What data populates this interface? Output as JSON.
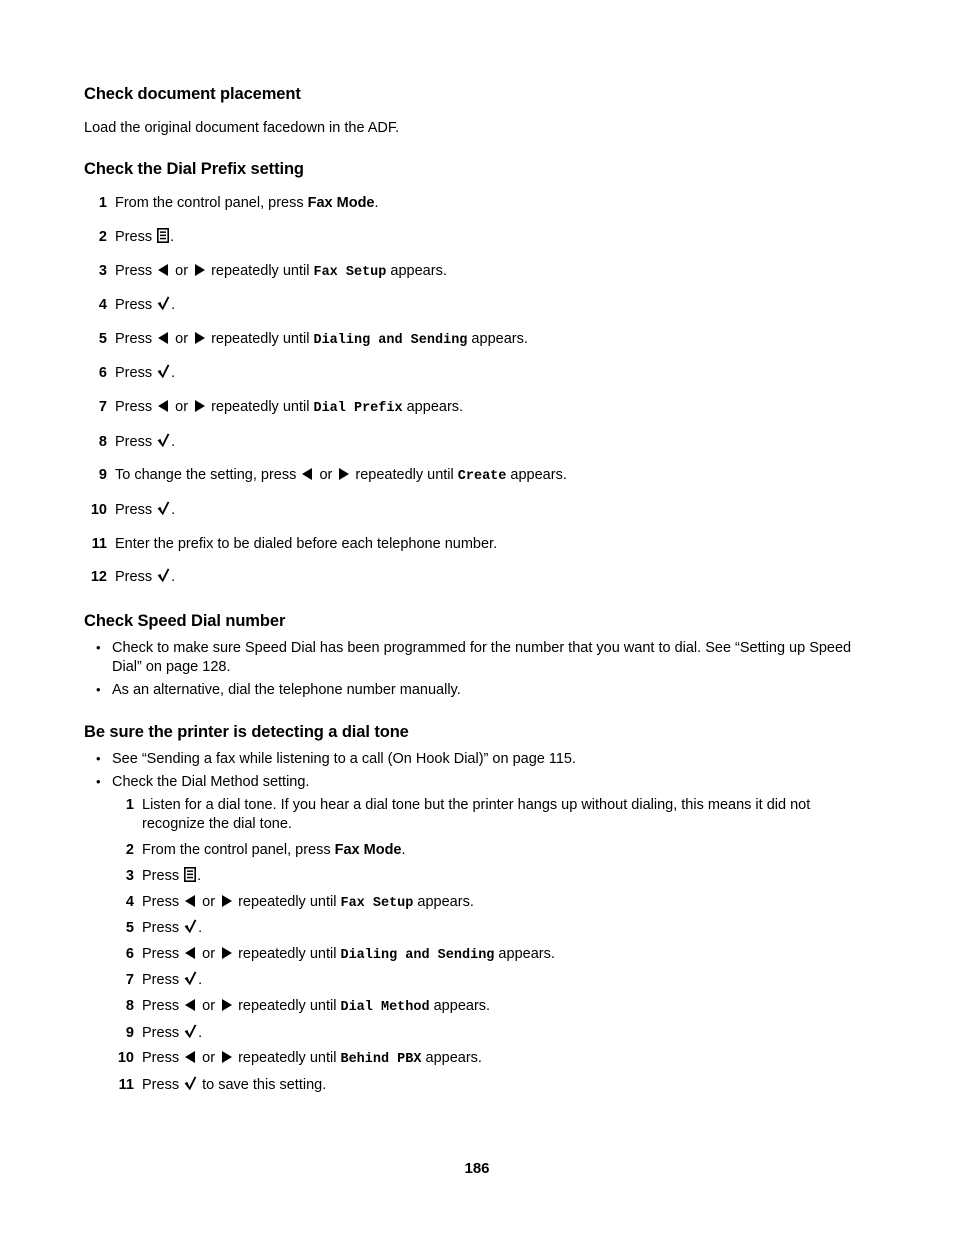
{
  "page": {
    "number": "186"
  },
  "sections": [
    {
      "heading": "Check document placement",
      "body": "Load the original document facedown in the ADF."
    },
    {
      "heading": "Check the Dial Prefix setting",
      "steps": [
        {
          "num": "1",
          "pre": "From the control panel, press ",
          "strong": "Fax Mode",
          "post": "."
        },
        {
          "num": "2",
          "pre": "Press ",
          "icon": "menu-icon",
          "post": "."
        },
        {
          "num": "3",
          "pre": "Press ",
          "icon": "arrows",
          "mid": " repeatedly until ",
          "lcd": "Fax Setup",
          "post": " appears."
        },
        {
          "num": "4",
          "pre": "Press ",
          "icon": "check-icon",
          "post": "."
        },
        {
          "num": "5",
          "pre": "Press ",
          "icon": "arrows",
          "mid": " repeatedly until ",
          "lcd": "Dialing and Sending",
          "post": " appears."
        },
        {
          "num": "6",
          "pre": "Press ",
          "icon": "check-icon",
          "post": "."
        },
        {
          "num": "7",
          "pre": "Press ",
          "icon": "arrows",
          "mid": " repeatedly until ",
          "lcd": "Dial Prefix",
          "post": " appears."
        },
        {
          "num": "8",
          "pre": "Press ",
          "icon": "check-icon",
          "post": "."
        },
        {
          "num": "9",
          "pre": "To change the setting, press ",
          "icon": "arrows",
          "mid": " repeatedly until ",
          "lcd": "Create",
          "post": " appears."
        },
        {
          "num": "10",
          "pre": "Press ",
          "icon": "check-icon",
          "post": "."
        },
        {
          "num": "11",
          "pre": "Enter the prefix to be dialed before each telephone number.",
          "post": ""
        },
        {
          "num": "12",
          "pre": "Press ",
          "icon": "check-icon",
          "post": "."
        }
      ]
    },
    {
      "heading": "Check Speed Dial number",
      "bullets": [
        {
          "text": "Check to make sure Speed Dial has been programmed for the number that you want to dial. See “Setting up Speed Dial” on page 128."
        },
        {
          "text": "As an alternative, dial the telephone number manually."
        }
      ]
    },
    {
      "heading": "Be sure the printer is detecting a dial tone",
      "bullets": [
        {
          "text": "See “Sending a fax while listening to a call (On Hook Dial)” on page 115."
        },
        {
          "text": "Check the Dial Method setting."
        }
      ],
      "nested_steps": [
        {
          "num": "1",
          "pre": "Listen for a dial tone. If you hear a dial tone but the printer hangs up without dialing, this means it did not recognize the dial tone.",
          "post": ""
        },
        {
          "num": "2",
          "pre": "From the control panel, press ",
          "strong": "Fax Mode",
          "post": "."
        },
        {
          "num": "3",
          "pre": "Press ",
          "icon": "menu-icon",
          "post": "."
        },
        {
          "num": "4",
          "pre": "Press ",
          "icon": "arrows",
          "mid": " repeatedly until ",
          "lcd": "Fax Setup",
          "post": " appears."
        },
        {
          "num": "5",
          "pre": "Press ",
          "icon": "check-icon",
          "post": "."
        },
        {
          "num": "6",
          "pre": "Press ",
          "icon": "arrows",
          "mid": " repeatedly until ",
          "lcd": "Dialing and Sending",
          "post": " appears."
        },
        {
          "num": "7",
          "pre": "Press ",
          "icon": "check-icon",
          "post": "."
        },
        {
          "num": "8",
          "pre": "Press ",
          "icon": "arrows",
          "mid": " repeatedly until ",
          "lcd": "Dial Method",
          "post": " appears."
        },
        {
          "num": "9",
          "pre": "Press ",
          "icon": "check-icon",
          "post": "."
        },
        {
          "num": "10",
          "pre": "Press ",
          "icon": "arrows",
          "mid": " repeatedly until ",
          "lcd": "Behind PBX",
          "post": " appears."
        },
        {
          "num": "11",
          "pre": "Press ",
          "icon": "check-icon",
          "post": " to save this setting."
        }
      ]
    }
  ],
  "icons": {
    "menu": "menu-icon",
    "arrow_left": "arrow-left-icon",
    "arrow_right": "arrow-right-icon",
    "check": "check-icon",
    "bullet": "bullet-dot",
    "or_label": "or"
  }
}
